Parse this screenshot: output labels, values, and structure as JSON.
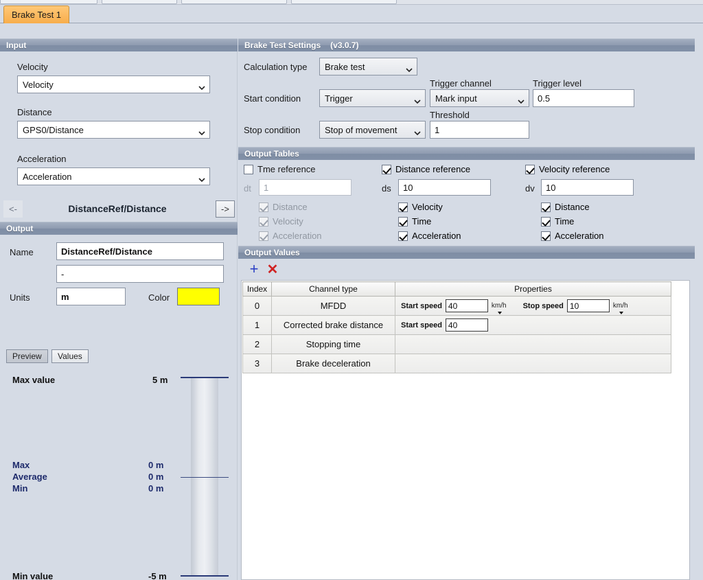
{
  "tab": {
    "label": "Brake Test 1"
  },
  "input_panel": {
    "header": "Input",
    "velocity_label": "Velocity",
    "velocity_value": "Velocity",
    "distance_label": "Distance",
    "distance_value": "GPS0/Distance",
    "acceleration_label": "Acceleration",
    "acceleration_value": "Acceleration",
    "prev_label": "<-",
    "next_label": "->",
    "channel_title": "DistanceRef/Distance"
  },
  "output_panel": {
    "header": "Output",
    "name_label": "Name",
    "name_value": "DistanceRef/Distance",
    "description_value": "-",
    "units_label": "Units",
    "units_value": "m",
    "color_label": "Color",
    "color_value": "#ffff00",
    "preview_tab": "Preview",
    "values_tab": "Values",
    "max_value_label": "Max value",
    "max_value": "5 m",
    "min_value_label": "Min value",
    "min_value": "-5 m",
    "stats": [
      {
        "label": "Max",
        "value": "0 m"
      },
      {
        "label": "Average",
        "value": "0 m"
      },
      {
        "label": "Min",
        "value": "0 m"
      }
    ]
  },
  "settings_panel": {
    "header": "Brake Test Settings",
    "version": "(v3.0.7)",
    "calculation_type_label": "Calculation type",
    "calculation_type_value": "Brake test",
    "start_condition_label": "Start condition",
    "start_condition_value": "Trigger",
    "trigger_channel_label": "Trigger channel",
    "trigger_channel_value": "Mark input",
    "trigger_level_label": "Trigger level",
    "trigger_level_value": "0.5",
    "stop_condition_label": "Stop condition",
    "stop_condition_value": "Stop of movement",
    "threshold_label": "Threshold",
    "threshold_value": "1"
  },
  "output_tables": {
    "header": "Output Tables",
    "columns": [
      {
        "ref_label": "Tme reference",
        "ref_checked": false,
        "step_label": "dt",
        "step_value": "1",
        "enabled": false,
        "options": [
          {
            "label": "Distance",
            "checked": true
          },
          {
            "label": "Velocity",
            "checked": true
          },
          {
            "label": "Acceleration",
            "checked": true
          }
        ]
      },
      {
        "ref_label": "Distance reference",
        "ref_checked": true,
        "step_label": "ds",
        "step_value": "10",
        "enabled": true,
        "options": [
          {
            "label": "Velocity",
            "checked": true
          },
          {
            "label": "Time",
            "checked": true
          },
          {
            "label": "Acceleration",
            "checked": true
          }
        ]
      },
      {
        "ref_label": "Velocity reference",
        "ref_checked": true,
        "step_label": "dv",
        "step_value": "10",
        "enabled": true,
        "options": [
          {
            "label": "Distance",
            "checked": true
          },
          {
            "label": "Time",
            "checked": true
          },
          {
            "label": "Acceleration",
            "checked": true
          }
        ]
      }
    ]
  },
  "output_values": {
    "header": "Output Values",
    "add_icon": "plus-icon",
    "remove_icon": "delete-x-icon",
    "columns": [
      "Index",
      "Channel type",
      "Properties"
    ],
    "rows": [
      {
        "index": "0",
        "channel_type": "MFDD",
        "props": [
          {
            "label": "Start speed",
            "value": "40",
            "unit": "km/h"
          },
          {
            "label": "Stop speed",
            "value": "10",
            "unit": "km/h"
          }
        ]
      },
      {
        "index": "1",
        "channel_type": "Corrected brake distance",
        "props": [
          {
            "label": "Start speed",
            "value": "40",
            "unit": ""
          }
        ]
      },
      {
        "index": "2",
        "channel_type": "Stopping time",
        "props": []
      },
      {
        "index": "3",
        "channel_type": "Brake deceleration",
        "props": []
      }
    ]
  }
}
